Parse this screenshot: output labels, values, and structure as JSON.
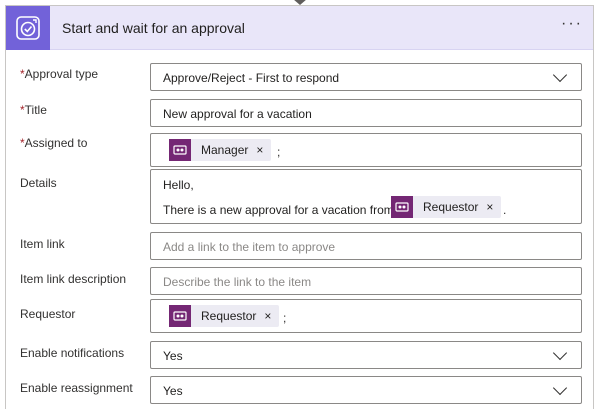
{
  "header": {
    "title": "Start and wait for an approval",
    "more_label": "···"
  },
  "fields": {
    "approval_type": {
      "label": "Approval type",
      "required": "*",
      "value": "Approve/Reject - First to respond"
    },
    "title": {
      "label": "Title",
      "required": "*",
      "value": "New approval for a vacation"
    },
    "assigned_to": {
      "label": "Assigned to",
      "required": "*",
      "token": "Manager",
      "remove": "×",
      "separator": ";"
    },
    "details": {
      "label": "Details",
      "line1": "Hello,",
      "line2": "There is a new approval for a vacation from",
      "token": "Requestor",
      "remove": "×",
      "trailing": "."
    },
    "item_link": {
      "label": "Item link",
      "placeholder": "Add a link to the item to approve"
    },
    "item_link_description": {
      "label": "Item link description",
      "placeholder": "Describe the link to the item"
    },
    "requestor": {
      "label": "Requestor",
      "token": "Requestor",
      "remove": "×",
      "separator": ";"
    },
    "enable_notifications": {
      "label": "Enable notifications",
      "value": "Yes"
    },
    "enable_reassignment": {
      "label": "Enable reassignment",
      "value": "Yes"
    }
  },
  "icons": {
    "header": "approval-icon",
    "token": "dynamic-content-icon",
    "dropdown": "chevron-down-icon"
  },
  "colors": {
    "header_bg": "#e9e6f9",
    "header_icon_bg": "#7262d9",
    "token_icon_bg": "#742774",
    "token_bg": "#ecebf3",
    "required": "#a4262c"
  }
}
